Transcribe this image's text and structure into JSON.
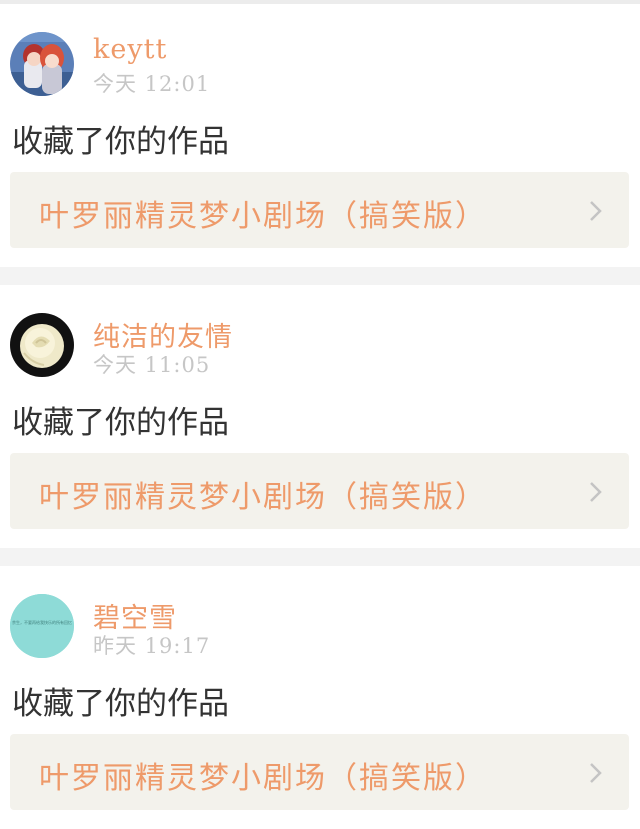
{
  "feed": [
    {
      "user_name": "keytt",
      "time": "今天 12:01",
      "action": "收藏了你的作品",
      "work_title": "叶罗丽精灵梦小剧场（搞笑版）",
      "avatar": "anime-couple-avatar",
      "avatar_text": ""
    },
    {
      "user_name": "纯洁的友情",
      "time": "今天 11:05",
      "action": "收藏了你的作品",
      "work_title": "叶罗丽精灵梦小剧场（搞笑版）",
      "avatar": "white-rose-avatar",
      "avatar_text": ""
    },
    {
      "user_name": "碧空雪",
      "time": "昨天 19:17",
      "action": "收藏了你的作品",
      "work_title": "叶罗丽精灵梦小剧场（搞笑版）",
      "avatar": "teal-text-avatar",
      "avatar_text": "余生，不要再给我快乐的所有回忆"
    }
  ],
  "colors": {
    "accent": "#ee9a6a",
    "time": "#c6c6c6",
    "action": "#333333",
    "link_bg": "#f3f2ec",
    "separator": "#f3f3f3"
  }
}
